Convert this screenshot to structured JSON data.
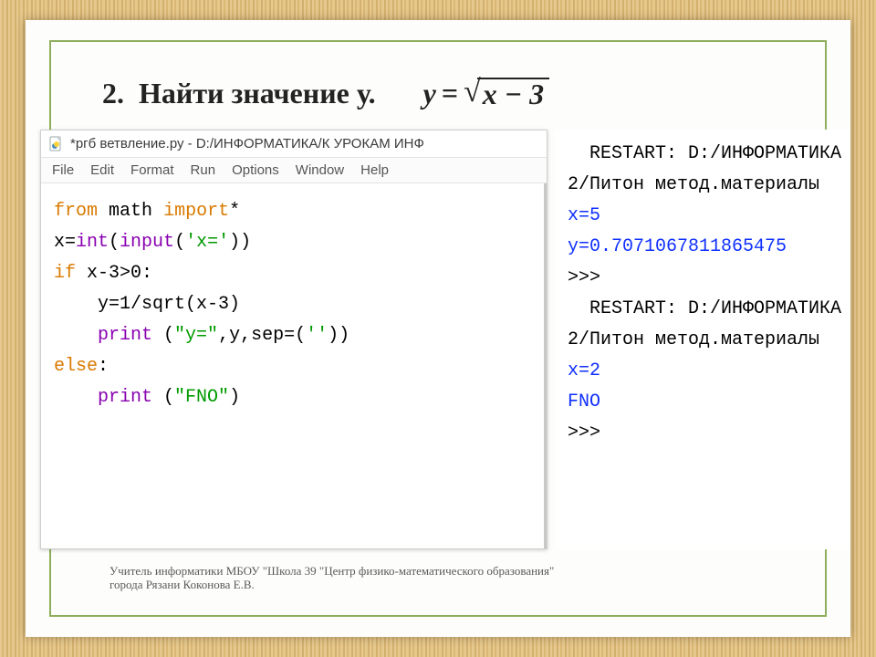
{
  "heading": {
    "number": "2.",
    "text": "Найти значение у.",
    "formula_lhs": "y",
    "formula_eq": "=",
    "formula_radicand": "x − 3"
  },
  "editor": {
    "title": "*ргб ветвление.ру - D:/ИНФОРМАТИКА/К УРОКАМ ИНФ",
    "menu": [
      "File",
      "Edit",
      "Format",
      "Run",
      "Options",
      "Window",
      "Help"
    ],
    "code": {
      "l1": {
        "from": "from",
        "math": "math",
        "import": "import",
        "star": "*"
      },
      "l2": {
        "x": "x=",
        "int": "int",
        "p1": "(",
        "input": "input",
        "p2": "(",
        "s": "'x='",
        "p3": "))"
      },
      "l3": {
        "if": "if",
        "cond": " x-3>0:"
      },
      "l4": {
        "indent": "    ",
        "body": "y=1/sqrt(x-3)"
      },
      "l5": {
        "indent": "    ",
        "print": "print",
        "rest1": " (",
        "s": "\"y=\"",
        "rest2": ",y,sep=(",
        "s2": "''",
        "rest3": "))"
      },
      "l6": {
        "else": "else",
        "colon": ":"
      },
      "l7": {
        "indent": "    ",
        "print": "print",
        "rest1": " (",
        "s": "\"FNO\"",
        "rest2": ")"
      }
    }
  },
  "shell": {
    "l1": "  RESTART: D:/ИНФОРМАТИКА",
    "l2": "2/Питон метод.материалы",
    "l3": "x=5",
    "l4": "y=0.7071067811865475",
    "l5": ">>> ",
    "l6": "  RESTART: D:/ИНФОРМАТИКА",
    "l7": "2/Питон метод.материалы",
    "l8": "x=2",
    "l9": "FNO",
    "l10": ">>> "
  },
  "footer": {
    "line1": "Учитель информатики МБОУ \"Школа 39 \"Центр физико-математического образования\"",
    "line2": "города Рязани Коконова Е.В."
  }
}
